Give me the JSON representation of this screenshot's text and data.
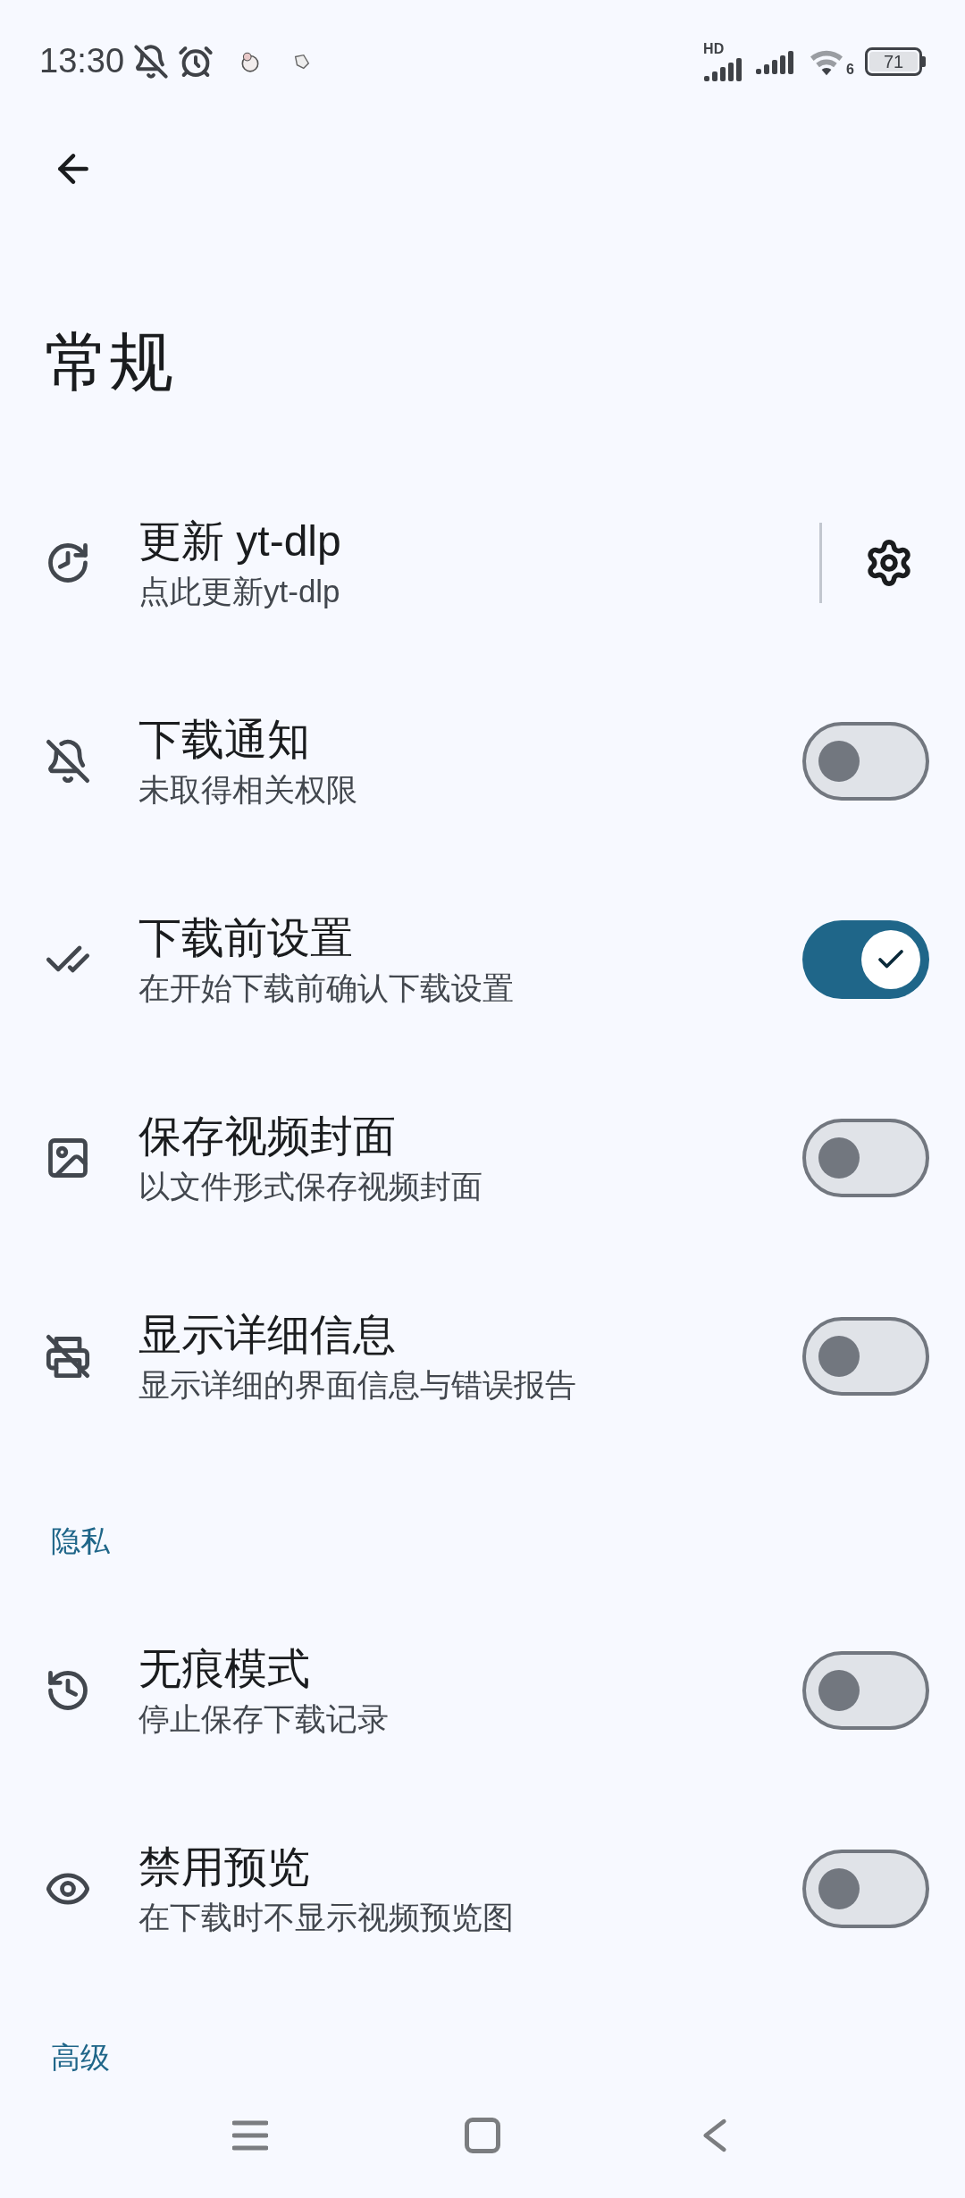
{
  "status_bar": {
    "time": "13:30",
    "network_badge": "HD",
    "wifi_badge": "6",
    "battery": "71"
  },
  "page": {
    "title": "常规"
  },
  "sections": [
    {
      "items": [
        {
          "kind": "action",
          "title": "更新 yt-dlp",
          "subtitle": "点此更新yt-dlp"
        },
        {
          "kind": "switch",
          "title": "下载通知",
          "subtitle": "未取得相关权限",
          "on": false
        },
        {
          "kind": "switch",
          "title": "下载前设置",
          "subtitle": "在开始下载前确认下载设置",
          "on": true
        },
        {
          "kind": "switch",
          "title": "保存视频封面",
          "subtitle": "以文件形式保存视频封面",
          "on": false
        },
        {
          "kind": "switch",
          "title": "显示详细信息",
          "subtitle": "显示详细的界面信息与错误报告",
          "on": false
        }
      ]
    },
    {
      "header": "隐私",
      "items": [
        {
          "kind": "switch",
          "title": "无痕模式",
          "subtitle": "停止保存下载记录",
          "on": false
        },
        {
          "kind": "switch",
          "title": "禁用预览",
          "subtitle": "在下载时不显示视频预览图",
          "on": false
        }
      ]
    },
    {
      "header": "高级"
    }
  ]
}
